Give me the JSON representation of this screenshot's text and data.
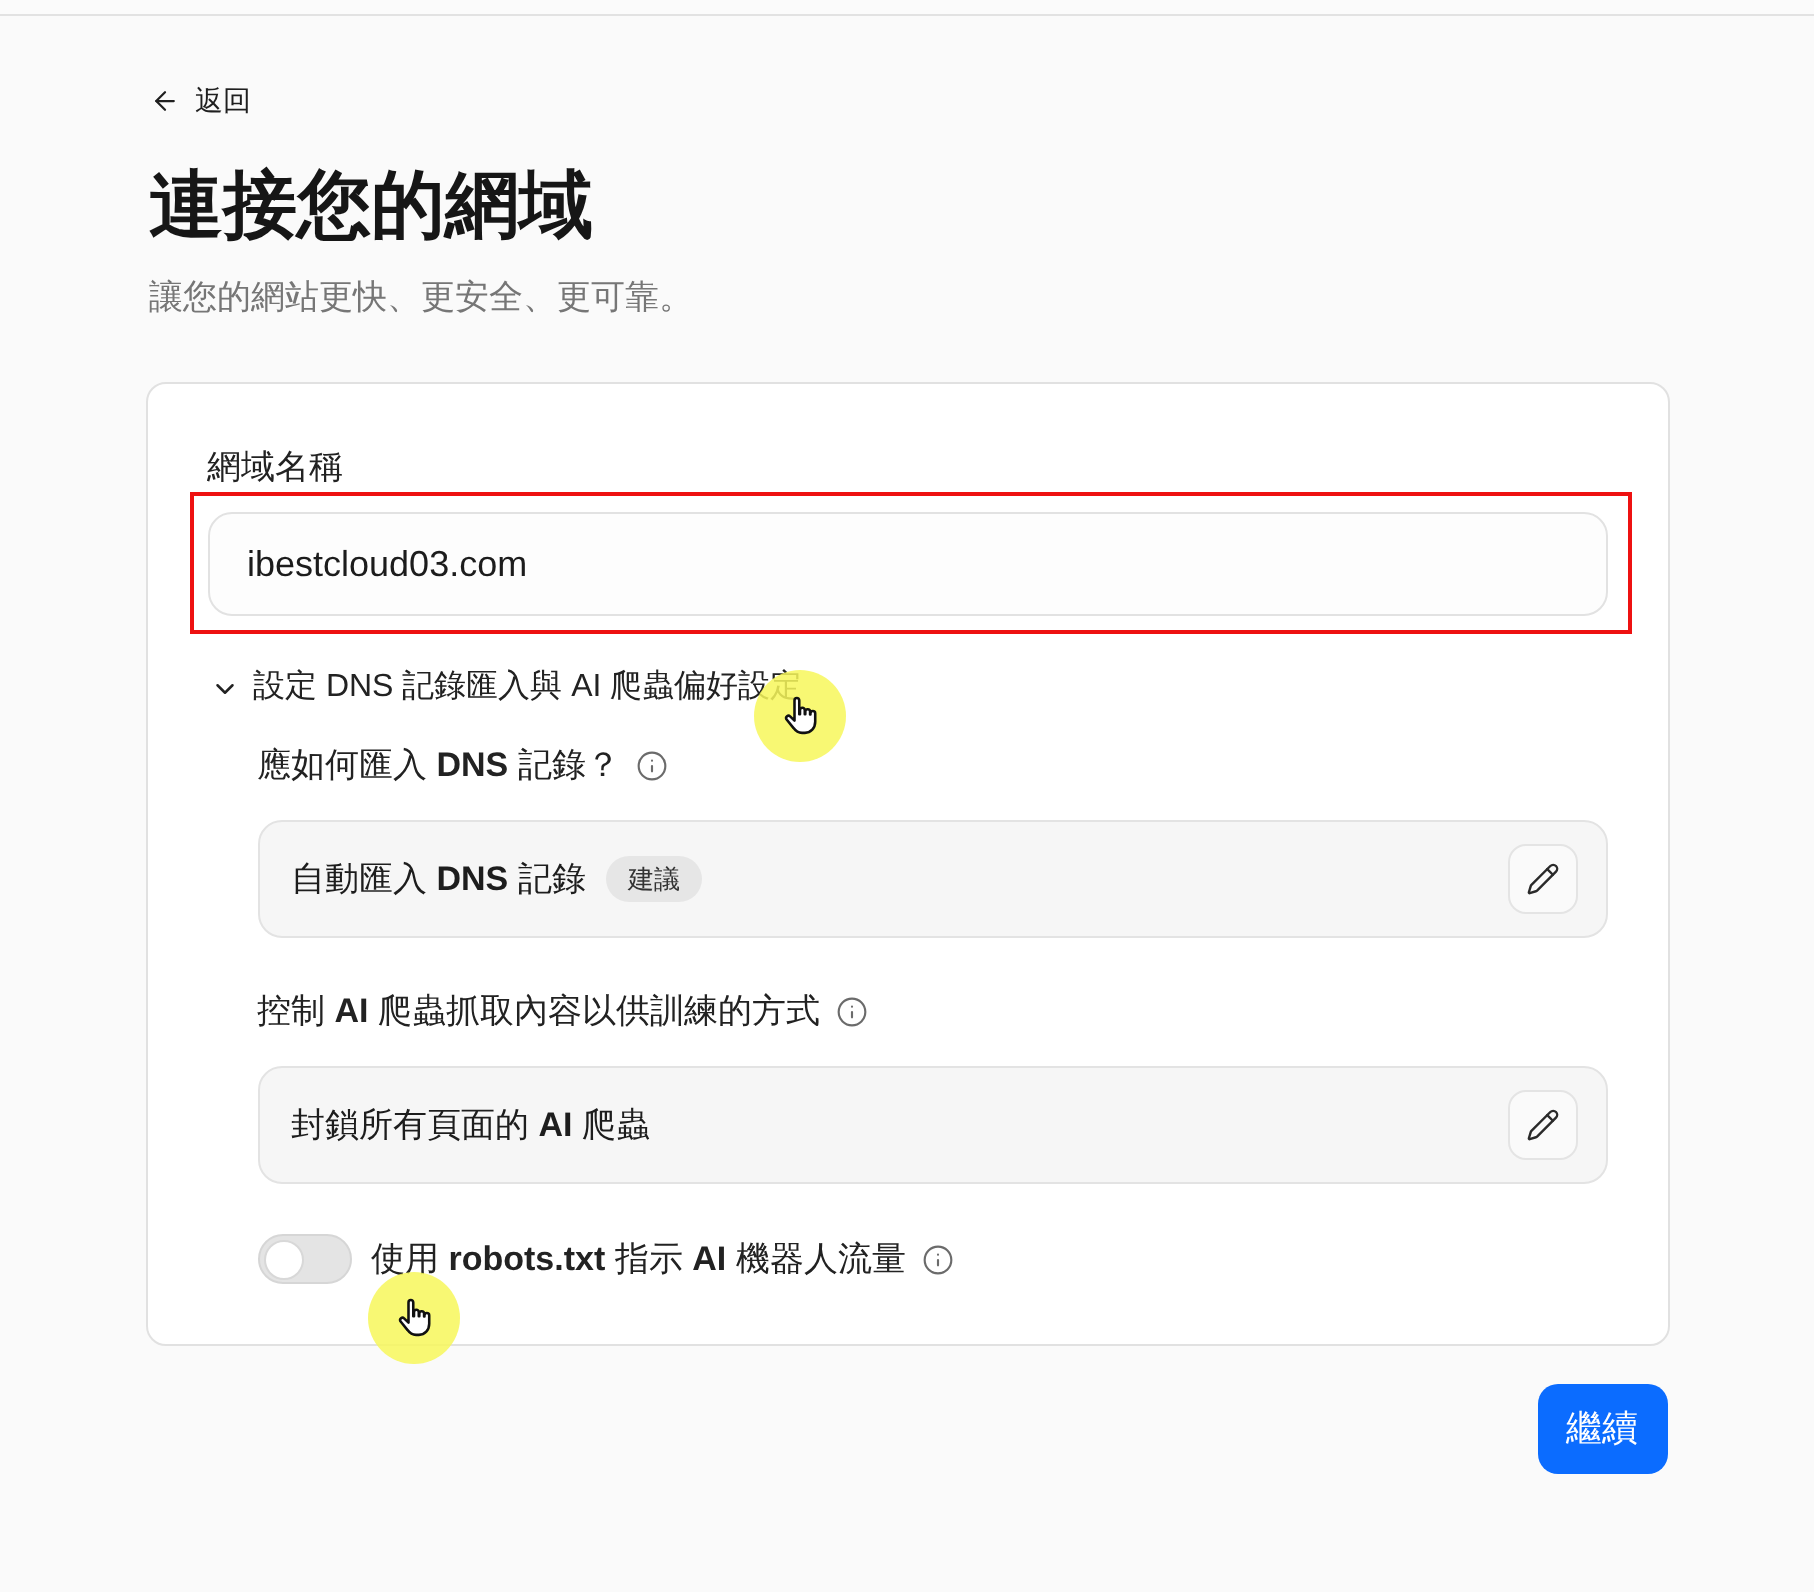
{
  "back_link": {
    "label": "返回"
  },
  "title": "連接您的網域",
  "subtitle": "讓您的網站更快、更安全、更可靠。",
  "domain_field": {
    "label": "網域名稱",
    "value": "ibestcloud03.com"
  },
  "advanced_section": {
    "label": "設定 DNS 記錄匯入與 AI 爬蟲偏好設定",
    "expanded": true,
    "settings": [
      {
        "question": "應如何匯入 **DNS** 記錄？",
        "value": "自動匯入 **DNS** 記錄",
        "badge": "建議"
      },
      {
        "question": "控制 **AI** 爬蟲抓取內容以供訓練的方式",
        "value": "封鎖所有頁面的 **AI** 爬蟲"
      }
    ],
    "robots_toggle": {
      "label": "使用 **robots.txt** 指示 **AI** 機器人流量",
      "on": false
    }
  },
  "continue_button": "繼續"
}
